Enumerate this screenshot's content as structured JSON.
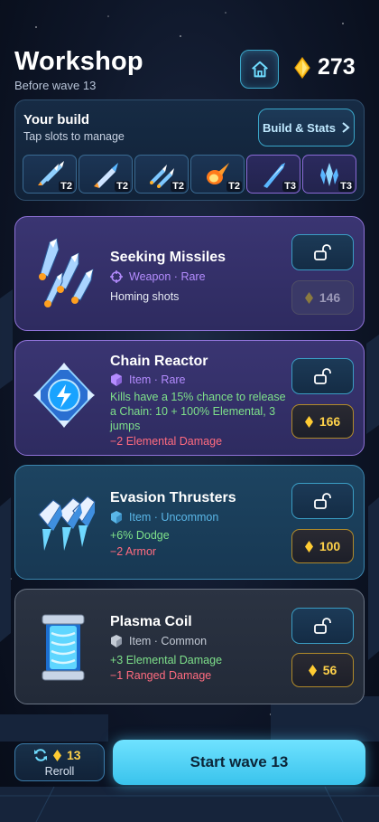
{
  "header": {
    "title": "Workshop",
    "subtitle": "Before wave 13",
    "gold": "273"
  },
  "build": {
    "title": "Your build",
    "subtitle": "Tap slots to manage",
    "stats_button": "Build & Stats",
    "slots": [
      {
        "icon": "missile-cluster-icon",
        "tier": "T2"
      },
      {
        "icon": "rocket-icon",
        "tier": "T2"
      },
      {
        "icon": "twin-missile-icon",
        "tier": "T2"
      },
      {
        "icon": "fireball-icon",
        "tier": "T2"
      },
      {
        "icon": "blue-blade-icon",
        "tier": "T3"
      },
      {
        "icon": "ice-crystal-icon",
        "tier": "T3"
      }
    ]
  },
  "shop": [
    {
      "name": "Seeking Missiles",
      "type": "Weapon · Rare",
      "type_icon": "crosshair-icon",
      "type_color": "#b48cff",
      "lines": [
        {
          "text": "Homing shots",
          "kind": "plain"
        }
      ],
      "price": "146",
      "affordable": false
    },
    {
      "name": "Chain Reactor",
      "type": "Item · Rare",
      "type_icon": "cube-icon",
      "type_color": "#b48cff",
      "lines": [
        {
          "text": "Kills have a 15% chance to release a Chain: 10 + 100% Elemental, 3 jumps",
          "kind": "pos"
        },
        {
          "text": "−2 Elemental Damage",
          "kind": "neg"
        }
      ],
      "price": "166",
      "affordable": true
    },
    {
      "name": "Evasion Thrusters",
      "type": "Item · Uncommon",
      "type_icon": "cube-icon",
      "type_color": "#5ab7e8",
      "lines": [
        {
          "text": "+6% Dodge",
          "kind": "pos"
        },
        {
          "text": "−2 Armor",
          "kind": "neg"
        }
      ],
      "price": "100",
      "affordable": true
    },
    {
      "name": "Plasma Coil",
      "type": "Item · Common",
      "type_icon": "cube-icon",
      "type_color": "#c4cbd6",
      "lines": [
        {
          "text": "+3 Elemental Damage",
          "kind": "pos"
        },
        {
          "text": "−1 Ranged Damage",
          "kind": "neg"
        }
      ],
      "price": "56",
      "affordable": true
    }
  ],
  "footer": {
    "reroll_cost": "13",
    "reroll_label": "Reroll",
    "start_label": "Start wave 13"
  },
  "colors": {
    "gold": "#ffd24a",
    "accent": "#4fd3ff",
    "positive": "#7ee08a",
    "negative": "#ff6b7f"
  }
}
